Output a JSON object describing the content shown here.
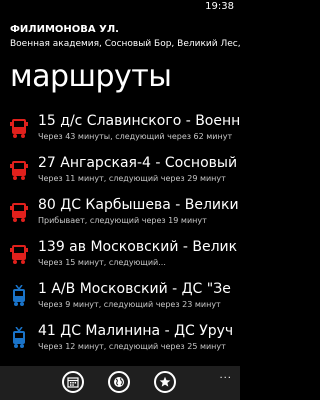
{
  "status": {
    "time": "19:38"
  },
  "header": {
    "street": "ФИЛИМОНОВА УЛ.",
    "stops": "Военная академия, Сосновый Бор, Великий Лес, ДС \""
  },
  "page": {
    "title": "маршруты"
  },
  "routes": [
    {
      "title": "15 д/с Славинского - Военн",
      "sub": "Через 43 минуты, следующий через 62 минут",
      "type": "bus",
      "icon": "bus-icon",
      "color": "#e0201c"
    },
    {
      "title": "27 Ангарская-4 - Сосновый",
      "sub": "Через 11 минут, следующий через 29 минут",
      "type": "bus",
      "icon": "bus-icon",
      "color": "#e0201c"
    },
    {
      "title": "80 ДС Карбышева - Велики",
      "sub": "Прибывает, следующий через 19 минут",
      "type": "bus",
      "icon": "bus-icon",
      "color": "#e0201c"
    },
    {
      "title": "139 ав Московский - Велик",
      "sub": "Через 15 минут, следующий...",
      "type": "bus",
      "icon": "bus-icon",
      "color": "#e0201c"
    },
    {
      "title": "1 А/В Московский - ДС \"Зе",
      "sub": "Через 9 минут, следующий через 23 минут",
      "type": "trolleybus",
      "icon": "trolleybus-icon",
      "color": "#1a73c8"
    },
    {
      "title": "41 ДС Малинина - ДС Уруч",
      "sub": "Через 12 минут, следующий через 25 минут",
      "type": "trolleybus",
      "icon": "trolleybus-icon",
      "color": "#1a73c8"
    }
  ],
  "appbar": {
    "buttons": [
      {
        "icon": "calendar-icon"
      },
      {
        "icon": "globe-icon"
      },
      {
        "icon": "star-icon"
      }
    ],
    "more": "..."
  }
}
